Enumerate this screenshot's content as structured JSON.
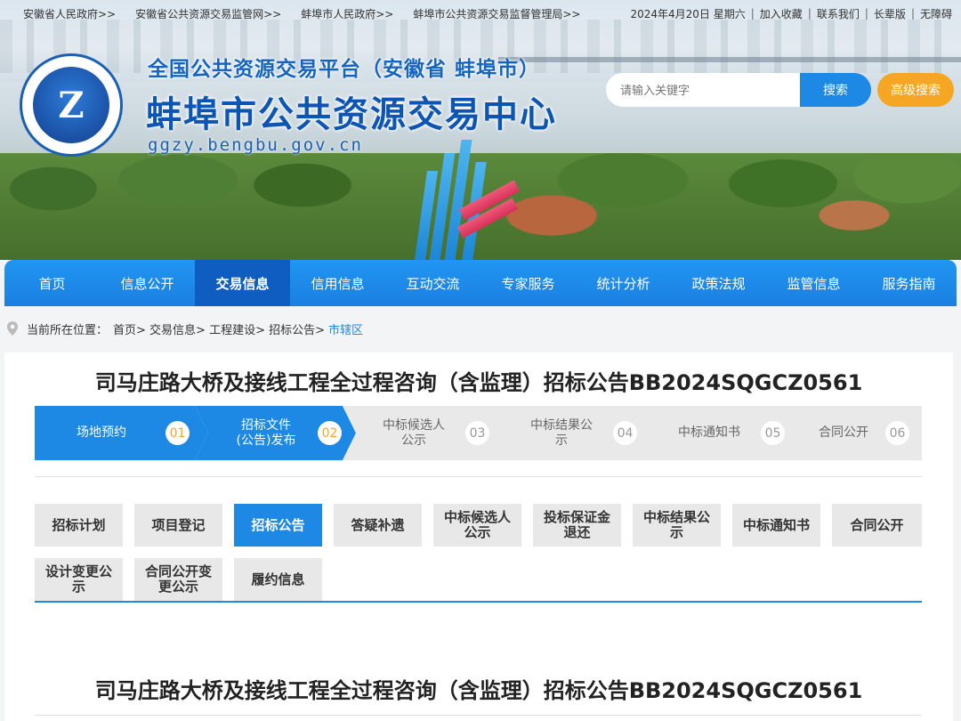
{
  "topbar": {
    "links": [
      "安徽省人民政府>>",
      "安徽省公共资源交易监管网>>",
      "蚌埠市人民政府>>",
      "蚌埠市公共资源交易监督管理局>>"
    ],
    "date": "2024年4月20日 星期六",
    "actions": [
      "加入收藏",
      "联系我们",
      "长辈版",
      "无障碍"
    ]
  },
  "header": {
    "subtitle": "全国公共资源交易平台（安徽省 蚌埠市）",
    "title": "蚌埠市公共资源交易中心",
    "url": "ggzy.bengbu.gov.cn"
  },
  "search": {
    "placeholder": "请输入关键字",
    "button": "搜索",
    "advanced": "高级搜索"
  },
  "nav": {
    "items": [
      "首页",
      "信息公开",
      "交易信息",
      "信用信息",
      "互动交流",
      "专家服务",
      "统计分析",
      "政策法规",
      "监管信息",
      "服务指南"
    ],
    "active": "交易信息"
  },
  "breadcrumb": {
    "label": "当前所在位置：",
    "path": "首页> 交易信息> 工程建设> 招标公告>",
    "current": "市辖区"
  },
  "page": {
    "title": "司马庄路大桥及接线工程全过程咨询（含监理）招标公告BB2024SQGCZ0561"
  },
  "steps": [
    {
      "label": "场地预约",
      "num": "01",
      "done": true
    },
    {
      "label": "招标文件\n(公告)发布",
      "num": "02",
      "done": true
    },
    {
      "label": "中标候选人\n公示",
      "num": "03",
      "done": false
    },
    {
      "label": "中标结果公\n示",
      "num": "04",
      "done": false
    },
    {
      "label": "中标通知书",
      "num": "05",
      "done": false
    },
    {
      "label": "合同公开",
      "num": "06",
      "done": false
    }
  ],
  "tabs": [
    {
      "label": "招标计划",
      "active": false
    },
    {
      "label": "项目登记",
      "active": false
    },
    {
      "label": "招标公告",
      "active": true
    },
    {
      "label": "答疑补遗",
      "active": false
    },
    {
      "label": "中标候选人公示",
      "active": false
    },
    {
      "label": "投标保证金退还",
      "active": false
    },
    {
      "label": "中标结果公示",
      "active": false
    },
    {
      "label": "中标通知书",
      "active": false
    },
    {
      "label": "合同公开",
      "active": false
    },
    {
      "label": "设计变更公示",
      "active": false
    },
    {
      "label": "合同公开变更公示",
      "active": false
    },
    {
      "label": "履约信息",
      "active": false
    }
  ],
  "colors": {
    "primary": "#1e88e5",
    "nav": "#2196f3",
    "nav_active": "#0f5dc0",
    "accent": "#f5a623",
    "step_off": "#e9e9e9"
  }
}
